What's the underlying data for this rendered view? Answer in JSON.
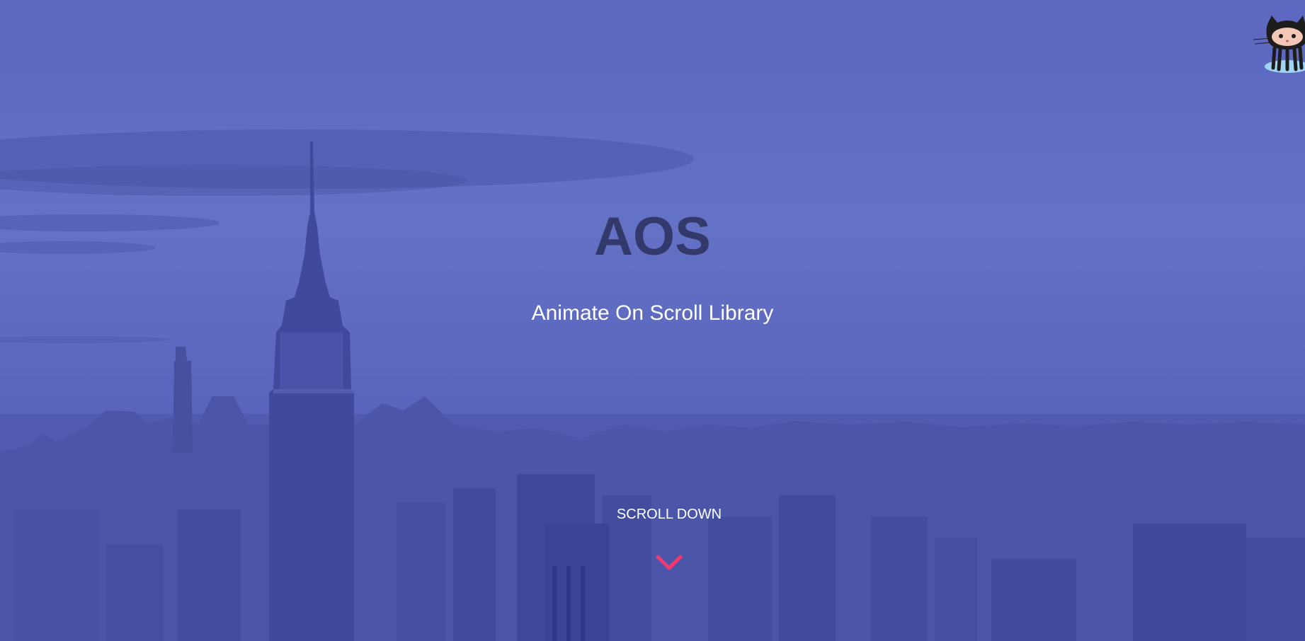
{
  "hero": {
    "title": "AOS",
    "subtitle": "Animate On Scroll Library",
    "scroll_label": "SCROLL DOWN"
  },
  "icons": {
    "github": "octocat-icon",
    "scroll": "chevron-down-icon"
  },
  "colors": {
    "overlay": "#5c67bf",
    "title": "#333a6b",
    "subtitle": "#ffffff",
    "chevron": "#f2386f"
  }
}
